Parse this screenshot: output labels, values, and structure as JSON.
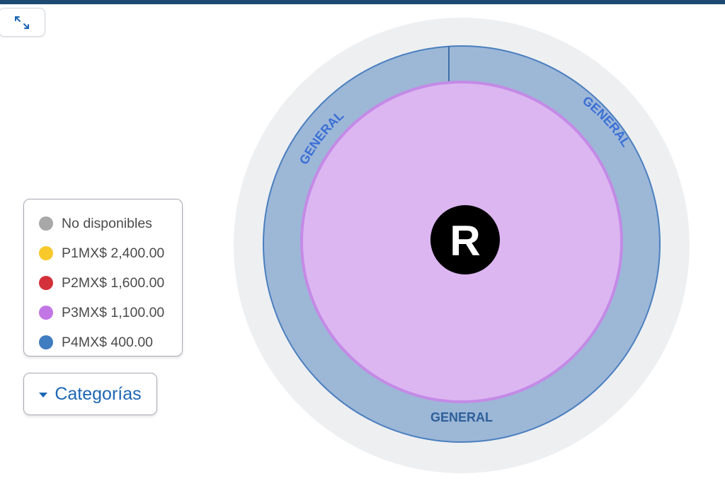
{
  "expand_button": {
    "icon": "expand-arrows-icon"
  },
  "legend": {
    "items": [
      {
        "label": "No disponibles",
        "color": "#a8a8a8"
      },
      {
        "label": "P1MX$ 2,400.00",
        "color": "#f8c92b"
      },
      {
        "label": "P2MX$ 1,600.00",
        "color": "#d4303a"
      },
      {
        "label": "P3MX$ 1,100.00",
        "color": "#c276e6"
      },
      {
        "label": "P4MX$ 400.00",
        "color": "#3f7cc0"
      }
    ]
  },
  "categories_button": {
    "label": "Categorías"
  },
  "venue": {
    "stage_label": "R",
    "sections": {
      "left": "GENERAL",
      "right": "GENERAL",
      "bottom": "GENERAL"
    },
    "colors": {
      "outer_backdrop": "#eeeff1",
      "ring_fill": "#9db7d7",
      "ring_stroke": "#4a7fbf",
      "center_fill": "#dcb6f1",
      "center_stroke": "#c48ae6",
      "stage_fill": "#000000"
    }
  }
}
